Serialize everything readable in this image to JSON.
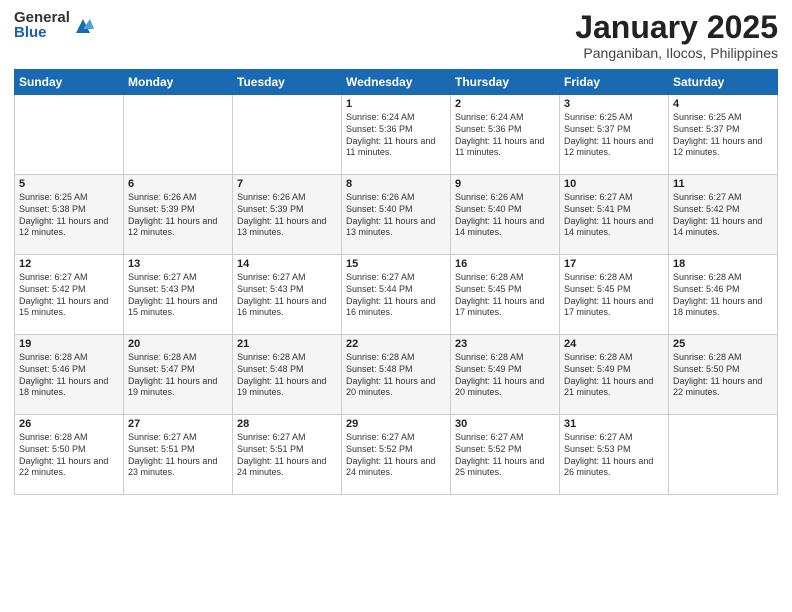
{
  "logo": {
    "general": "General",
    "blue": "Blue"
  },
  "title": {
    "month_year": "January 2025",
    "location": "Panganiban, Ilocos, Philippines"
  },
  "headers": [
    "Sunday",
    "Monday",
    "Tuesday",
    "Wednesday",
    "Thursday",
    "Friday",
    "Saturday"
  ],
  "weeks": [
    [
      {
        "day": "",
        "sunrise": "",
        "sunset": "",
        "daylight": ""
      },
      {
        "day": "",
        "sunrise": "",
        "sunset": "",
        "daylight": ""
      },
      {
        "day": "",
        "sunrise": "",
        "sunset": "",
        "daylight": ""
      },
      {
        "day": "1",
        "sunrise": "Sunrise: 6:24 AM",
        "sunset": "Sunset: 5:36 PM",
        "daylight": "Daylight: 11 hours and 11 minutes."
      },
      {
        "day": "2",
        "sunrise": "Sunrise: 6:24 AM",
        "sunset": "Sunset: 5:36 PM",
        "daylight": "Daylight: 11 hours and 11 minutes."
      },
      {
        "day": "3",
        "sunrise": "Sunrise: 6:25 AM",
        "sunset": "Sunset: 5:37 PM",
        "daylight": "Daylight: 11 hours and 12 minutes."
      },
      {
        "day": "4",
        "sunrise": "Sunrise: 6:25 AM",
        "sunset": "Sunset: 5:37 PM",
        "daylight": "Daylight: 11 hours and 12 minutes."
      }
    ],
    [
      {
        "day": "5",
        "sunrise": "Sunrise: 6:25 AM",
        "sunset": "Sunset: 5:38 PM",
        "daylight": "Daylight: 11 hours and 12 minutes."
      },
      {
        "day": "6",
        "sunrise": "Sunrise: 6:26 AM",
        "sunset": "Sunset: 5:39 PM",
        "daylight": "Daylight: 11 hours and 12 minutes."
      },
      {
        "day": "7",
        "sunrise": "Sunrise: 6:26 AM",
        "sunset": "Sunset: 5:39 PM",
        "daylight": "Daylight: 11 hours and 13 minutes."
      },
      {
        "day": "8",
        "sunrise": "Sunrise: 6:26 AM",
        "sunset": "Sunset: 5:40 PM",
        "daylight": "Daylight: 11 hours and 13 minutes."
      },
      {
        "day": "9",
        "sunrise": "Sunrise: 6:26 AM",
        "sunset": "Sunset: 5:40 PM",
        "daylight": "Daylight: 11 hours and 14 minutes."
      },
      {
        "day": "10",
        "sunrise": "Sunrise: 6:27 AM",
        "sunset": "Sunset: 5:41 PM",
        "daylight": "Daylight: 11 hours and 14 minutes."
      },
      {
        "day": "11",
        "sunrise": "Sunrise: 6:27 AM",
        "sunset": "Sunset: 5:42 PM",
        "daylight": "Daylight: 11 hours and 14 minutes."
      }
    ],
    [
      {
        "day": "12",
        "sunrise": "Sunrise: 6:27 AM",
        "sunset": "Sunset: 5:42 PM",
        "daylight": "Daylight: 11 hours and 15 minutes."
      },
      {
        "day": "13",
        "sunrise": "Sunrise: 6:27 AM",
        "sunset": "Sunset: 5:43 PM",
        "daylight": "Daylight: 11 hours and 15 minutes."
      },
      {
        "day": "14",
        "sunrise": "Sunrise: 6:27 AM",
        "sunset": "Sunset: 5:43 PM",
        "daylight": "Daylight: 11 hours and 16 minutes."
      },
      {
        "day": "15",
        "sunrise": "Sunrise: 6:27 AM",
        "sunset": "Sunset: 5:44 PM",
        "daylight": "Daylight: 11 hours and 16 minutes."
      },
      {
        "day": "16",
        "sunrise": "Sunrise: 6:28 AM",
        "sunset": "Sunset: 5:45 PM",
        "daylight": "Daylight: 11 hours and 17 minutes."
      },
      {
        "day": "17",
        "sunrise": "Sunrise: 6:28 AM",
        "sunset": "Sunset: 5:45 PM",
        "daylight": "Daylight: 11 hours and 17 minutes."
      },
      {
        "day": "18",
        "sunrise": "Sunrise: 6:28 AM",
        "sunset": "Sunset: 5:46 PM",
        "daylight": "Daylight: 11 hours and 18 minutes."
      }
    ],
    [
      {
        "day": "19",
        "sunrise": "Sunrise: 6:28 AM",
        "sunset": "Sunset: 5:46 PM",
        "daylight": "Daylight: 11 hours and 18 minutes."
      },
      {
        "day": "20",
        "sunrise": "Sunrise: 6:28 AM",
        "sunset": "Sunset: 5:47 PM",
        "daylight": "Daylight: 11 hours and 19 minutes."
      },
      {
        "day": "21",
        "sunrise": "Sunrise: 6:28 AM",
        "sunset": "Sunset: 5:48 PM",
        "daylight": "Daylight: 11 hours and 19 minutes."
      },
      {
        "day": "22",
        "sunrise": "Sunrise: 6:28 AM",
        "sunset": "Sunset: 5:48 PM",
        "daylight": "Daylight: 11 hours and 20 minutes."
      },
      {
        "day": "23",
        "sunrise": "Sunrise: 6:28 AM",
        "sunset": "Sunset: 5:49 PM",
        "daylight": "Daylight: 11 hours and 20 minutes."
      },
      {
        "day": "24",
        "sunrise": "Sunrise: 6:28 AM",
        "sunset": "Sunset: 5:49 PM",
        "daylight": "Daylight: 11 hours and 21 minutes."
      },
      {
        "day": "25",
        "sunrise": "Sunrise: 6:28 AM",
        "sunset": "Sunset: 5:50 PM",
        "daylight": "Daylight: 11 hours and 22 minutes."
      }
    ],
    [
      {
        "day": "26",
        "sunrise": "Sunrise: 6:28 AM",
        "sunset": "Sunset: 5:50 PM",
        "daylight": "Daylight: 11 hours and 22 minutes."
      },
      {
        "day": "27",
        "sunrise": "Sunrise: 6:27 AM",
        "sunset": "Sunset: 5:51 PM",
        "daylight": "Daylight: 11 hours and 23 minutes."
      },
      {
        "day": "28",
        "sunrise": "Sunrise: 6:27 AM",
        "sunset": "Sunset: 5:51 PM",
        "daylight": "Daylight: 11 hours and 24 minutes."
      },
      {
        "day": "29",
        "sunrise": "Sunrise: 6:27 AM",
        "sunset": "Sunset: 5:52 PM",
        "daylight": "Daylight: 11 hours and 24 minutes."
      },
      {
        "day": "30",
        "sunrise": "Sunrise: 6:27 AM",
        "sunset": "Sunset: 5:52 PM",
        "daylight": "Daylight: 11 hours and 25 minutes."
      },
      {
        "day": "31",
        "sunrise": "Sunrise: 6:27 AM",
        "sunset": "Sunset: 5:53 PM",
        "daylight": "Daylight: 11 hours and 26 minutes."
      },
      {
        "day": "",
        "sunrise": "",
        "sunset": "",
        "daylight": ""
      }
    ]
  ]
}
